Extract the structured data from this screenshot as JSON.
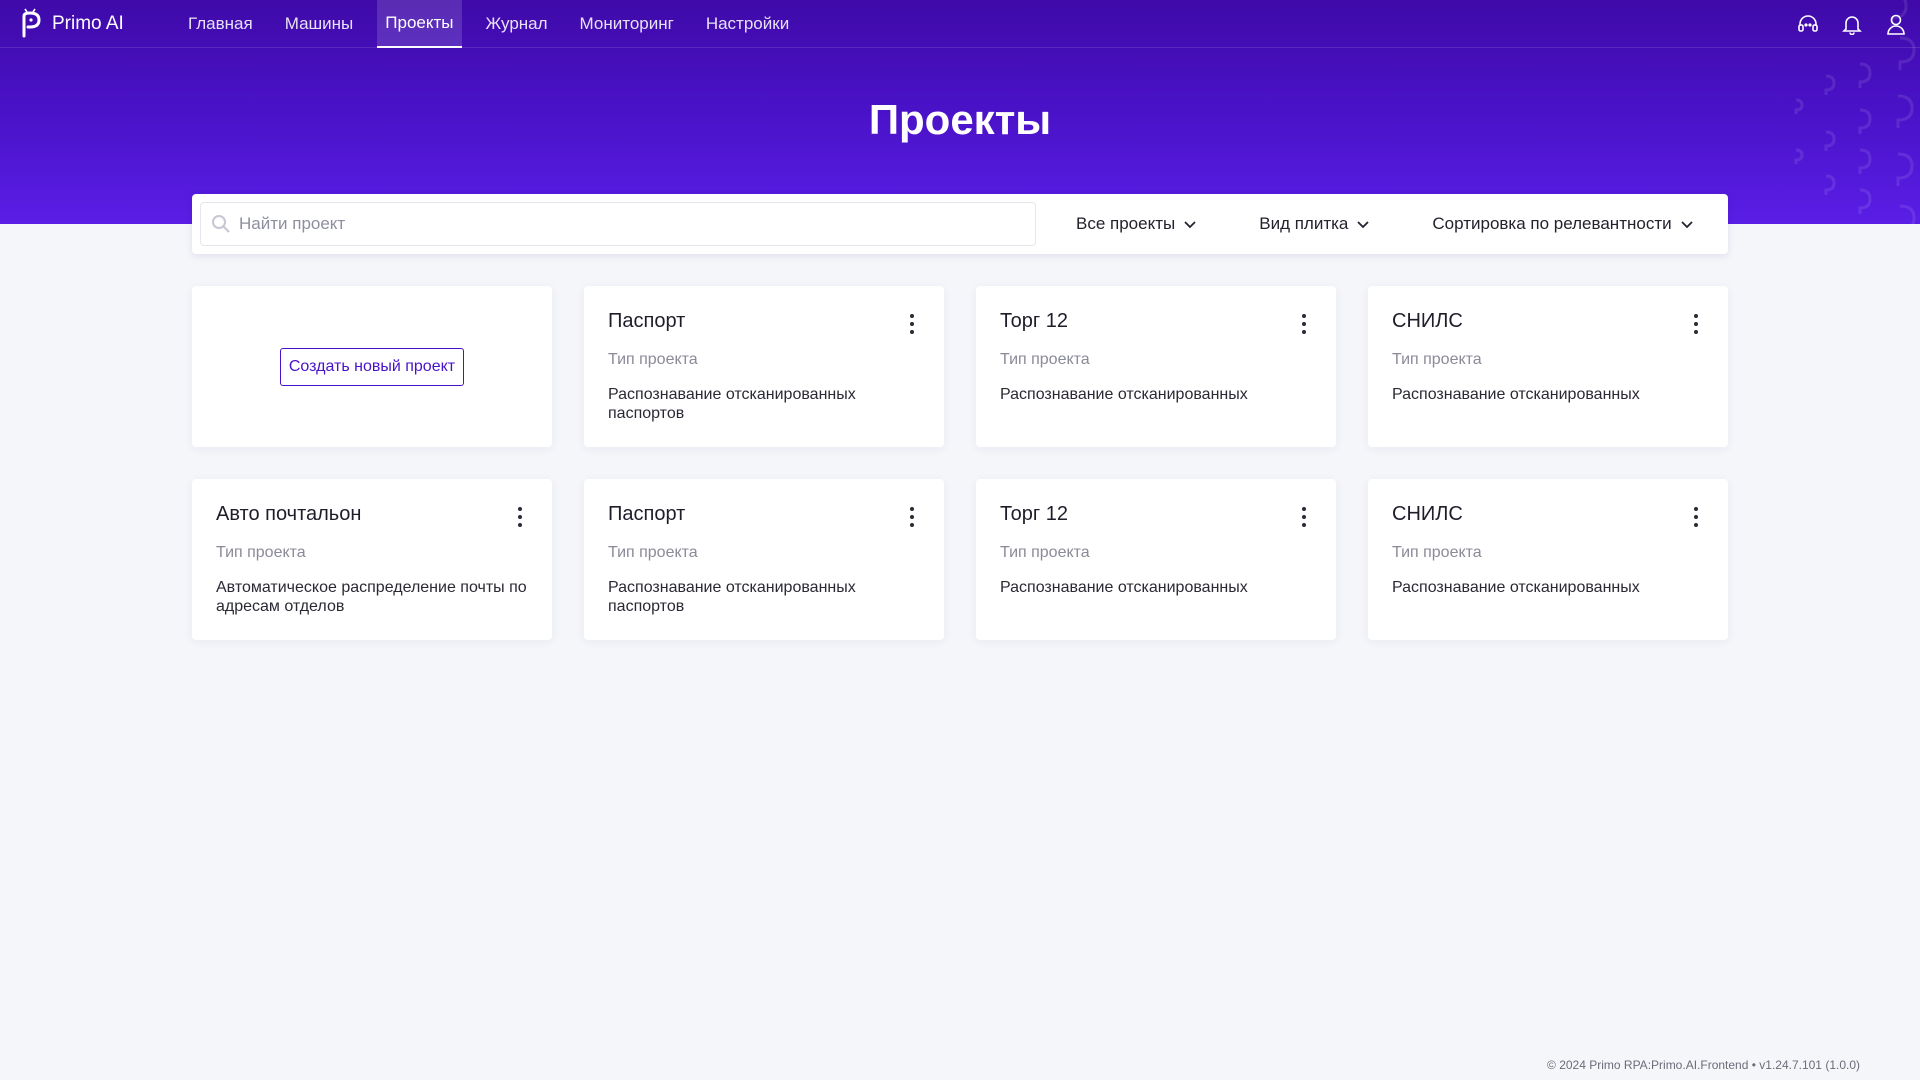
{
  "app": {
    "name": "Primo AI"
  },
  "nav": [
    {
      "label": "Главная",
      "active": false
    },
    {
      "label": "Машины",
      "active": false
    },
    {
      "label": "Проекты",
      "active": true
    },
    {
      "label": "Журнал",
      "active": false
    },
    {
      "label": "Мониторинг",
      "active": false
    },
    {
      "label": "Настройки",
      "active": false
    }
  ],
  "header_icons": [
    "support-icon",
    "bell-icon",
    "user-icon"
  ],
  "page": {
    "title": "Проекты"
  },
  "toolbar": {
    "search_placeholder": "Найти проект",
    "filter_label": "Все проекты",
    "view_label": "Вид плитка",
    "sort_label": "Сортировка по релевантности"
  },
  "create_label": "Создать новый проект",
  "projects": [
    {
      "title": "Паспорт",
      "type": "Тип проекта",
      "description": "Распознавание отсканированных паспортов"
    },
    {
      "title": "Торг 12",
      "type": "Тип проекта",
      "description": "Распознавание отсканированных"
    },
    {
      "title": "СНИЛС",
      "type": "Тип проекта",
      "description": "Распознавание отсканированных"
    },
    {
      "title": "Авто почтальон",
      "type": "Тип проекта",
      "description": "Автоматическое распределение почты по адресам отделов"
    },
    {
      "title": "Паспорт",
      "type": "Тип проекта",
      "description": "Распознавание отсканированных паспортов"
    },
    {
      "title": "Торг 12",
      "type": "Тип проекта",
      "description": "Распознавание отсканированных"
    },
    {
      "title": "СНИЛС",
      "type": "Тип проекта",
      "description": "Распознавание отсканированных"
    }
  ],
  "footer": {
    "text": "© 2024 Primo RPA:Primo.AI.Frontend • v1.24.7.101 (1.0.0)"
  },
  "colors": {
    "accent": "#4a12c8",
    "hero_top": "#3f0aa8",
    "hero_bottom": "#5a1ee6",
    "background": "#f5f6fa"
  }
}
